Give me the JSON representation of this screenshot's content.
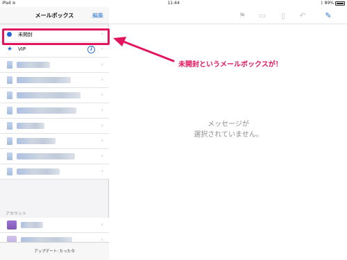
{
  "status_bar": {
    "device": "iPad",
    "time": "11:44",
    "battery": "89%"
  },
  "sidebar": {
    "title": "メールボックス",
    "edit_label": "編集",
    "items": [
      {
        "label": "未開封",
        "icon": "unread-dot-icon"
      },
      {
        "label": "VIP",
        "icon": "star-icon",
        "info_icon": "i"
      }
    ],
    "blurred_count": 8,
    "section_header": "アカウント",
    "footer": "アップデート: たった今"
  },
  "main": {
    "empty_message_line1": "メッセージが",
    "empty_message_line2": "選択されていません。",
    "toolbar_icons": [
      "flag-icon",
      "folder-icon",
      "trash-icon",
      "reply-icon",
      "compose-icon"
    ]
  },
  "annotation": {
    "text": "未開封というメールボックスが！",
    "color": "#e2145e"
  },
  "colors": {
    "accent": "#2b73d6",
    "highlight": "#e2145e"
  }
}
